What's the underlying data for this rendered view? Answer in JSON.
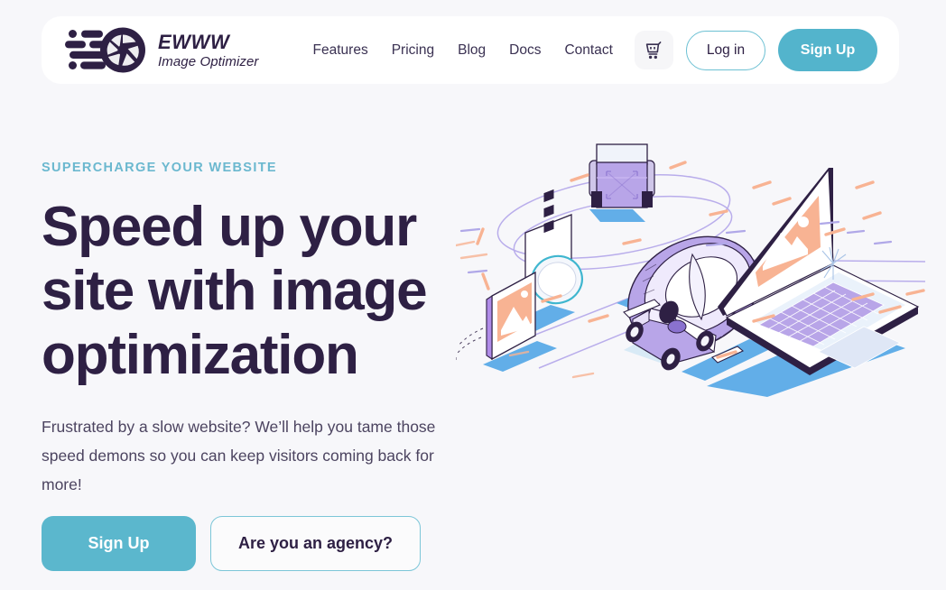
{
  "colors": {
    "page_background": "#f7f7fa",
    "header_card": "#ffffff",
    "accent_teal": "#53b4cc",
    "accent_teal_light": "#6bb8cf",
    "headline_dark": "#2e2044",
    "body_text": "#4c4460",
    "illustration_purple": "#b8a5e8",
    "illustration_purple_dark": "#8a72cf",
    "illustration_salmon": "#f8b393",
    "illustration_blue": "#62aee8",
    "illustration_ink": "#2e2044"
  },
  "header": {
    "logo": {
      "icon": "camera-aperture-speed-lines-icon",
      "line1": "EWWW",
      "line2": "Image Optimizer"
    },
    "nav_items": [
      {
        "label": "Features"
      },
      {
        "label": "Pricing"
      },
      {
        "label": "Blog"
      },
      {
        "label": "Docs"
      },
      {
        "label": "Contact"
      }
    ],
    "cart": {
      "icon": "shopping-cart-icon"
    },
    "login_label": "Log in",
    "signup_label": "Sign Up"
  },
  "hero": {
    "eyebrow": "SUPERCHARGE YOUR WEBSITE",
    "headline": "Speed up your site with image optimization",
    "subcopy": "Frustrated by a slow website? We’ll help you tame those speed demons so you can keep visitors coming back for more!",
    "primary_cta": "Sign Up",
    "secondary_cta": "Are you an agency?",
    "illustration": {
      "name": "speed-optimization-illustration",
      "elements": [
        "isometric-laptop-with-image-placeholder",
        "formula-one-race-car",
        "camera-lens-ring",
        "purple-engine-cube",
        "control-panel-with-buttons",
        "tilted-image-card",
        "orange-speed-dashes",
        "purple-motion-swooshes",
        "blue-shadow-bars"
      ]
    }
  }
}
